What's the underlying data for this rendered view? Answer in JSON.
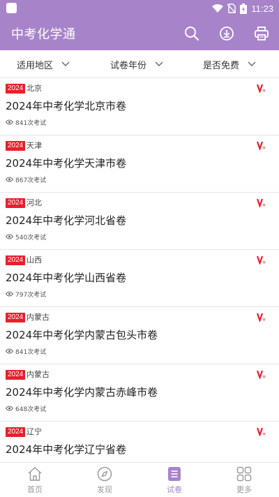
{
  "status_bar": {
    "time": "11:23"
  },
  "app_bar": {
    "title": "中考化学通",
    "icons": [
      "search-icon",
      "download-icon",
      "print-icon"
    ]
  },
  "filters": [
    {
      "label": "适用地区"
    },
    {
      "label": "试卷年份"
    },
    {
      "label": "是否免费"
    }
  ],
  "items": [
    {
      "year": "2024",
      "region": "北京",
      "title": "2024年中考化学北京市卷",
      "views": "841次考试"
    },
    {
      "year": "2024",
      "region": "天津",
      "title": "2024年中考化学天津市卷",
      "views": "867次考试"
    },
    {
      "year": "2024",
      "region": "河北",
      "title": "2024年中考化学河北省卷",
      "views": "540次考试"
    },
    {
      "year": "2024",
      "region": "山西",
      "title": "2024年中考化学山西省卷",
      "views": "797次考试"
    },
    {
      "year": "2024",
      "region": "内蒙古",
      "title": "2024年中考化学内蒙古包头市卷",
      "views": "841次考试"
    },
    {
      "year": "2024",
      "region": "内蒙古",
      "title": "2024年中考化学内蒙古赤峰市卷",
      "views": "648次考试"
    },
    {
      "year": "2024",
      "region": "辽宁",
      "title": "2024年中考化学辽宁省卷",
      "views": ""
    }
  ],
  "bottom_nav": [
    {
      "label": "首页",
      "icon": "home-icon",
      "active": false
    },
    {
      "label": "发现",
      "icon": "compass-icon",
      "active": false
    },
    {
      "label": "试卷",
      "icon": "paper-icon",
      "active": true
    },
    {
      "label": "更多",
      "icon": "grid-icon",
      "active": false
    }
  ],
  "colors": {
    "primary": "#a784c9",
    "badge": "#e8202b",
    "vip": "#e8202b"
  }
}
